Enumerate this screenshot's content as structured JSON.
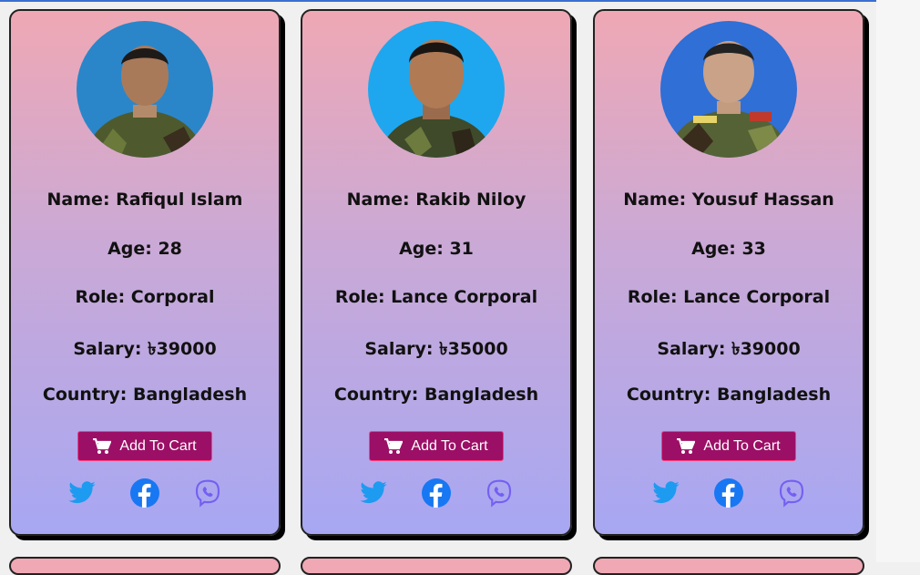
{
  "cards": [
    {
      "name_label": "Name: Rafiqul Islam",
      "age_label": "Age: 28",
      "role_label": "Role: Corporal",
      "salary_label": "Salary: ৳39000",
      "country_label": "Country: Bangladesh",
      "button_label": "Add To Cart"
    },
    {
      "name_label": "Name: Rakib Niloy",
      "age_label": "Age: 31",
      "role_label": "Role: Lance Corporal",
      "salary_label": "Salary: ৳35000",
      "country_label": "Country: Bangladesh",
      "button_label": "Add To Cart"
    },
    {
      "name_label": "Name: Yousuf Hassan",
      "age_label": "Age: 33",
      "role_label": "Role: Lance Corporal",
      "salary_label": "Salary: ৳39000",
      "country_label": "Country: Bangladesh",
      "button_label": "Add To Cart"
    }
  ],
  "icons": [
    "cart-icon",
    "twitter-icon",
    "facebook-icon",
    "viber-icon"
  ],
  "colors": {
    "card_gradient_top": "#efa8b4",
    "card_gradient_bottom": "#a7a7f3",
    "button_bg": "#9c0f66",
    "twitter": "#1d9bf0",
    "facebook": "#1877f2",
    "viber": "#7360f2"
  }
}
